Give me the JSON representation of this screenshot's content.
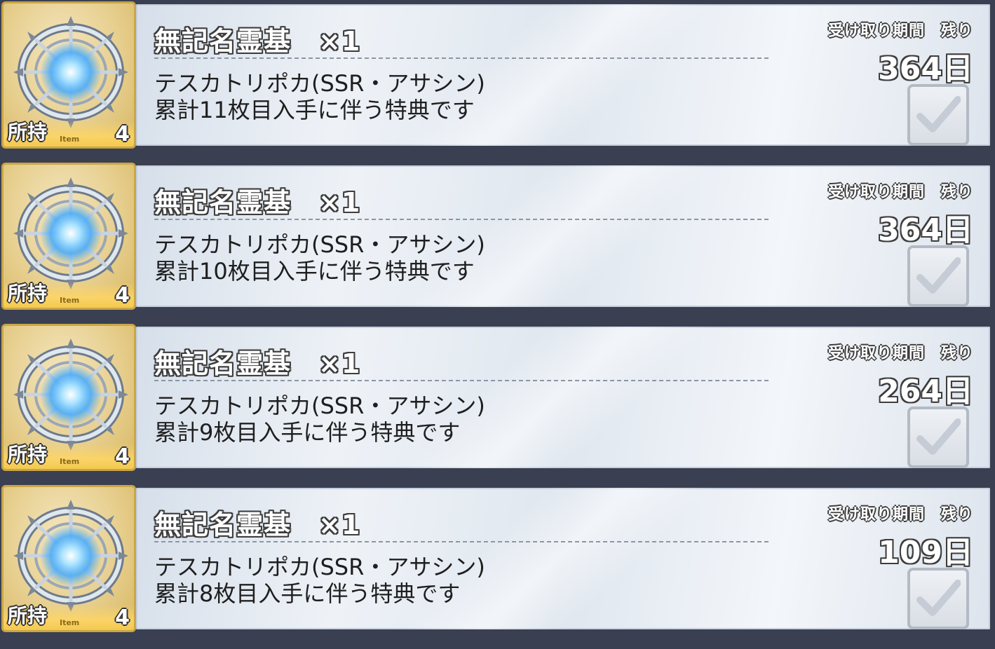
{
  "item_tag": "Item",
  "own_label": "所持",
  "period_label": "受け取り期間　残り",
  "rows": [
    {
      "title": "無記名霊基　×1",
      "desc_line1": "テスカトリポカ(SSR・アサシン)",
      "desc_line2": "累計11枚目入手に伴う特典です",
      "days": "364日",
      "own_count": "4"
    },
    {
      "title": "無記名霊基　×1",
      "desc_line1": "テスカトリポカ(SSR・アサシン)",
      "desc_line2": "累計10枚目入手に伴う特典です",
      "days": "364日",
      "own_count": "4"
    },
    {
      "title": "無記名霊基　×1",
      "desc_line1": "テスカトリポカ(SSR・アサシン)",
      "desc_line2": "累計9枚目入手に伴う特典です",
      "days": "264日",
      "own_count": "4"
    },
    {
      "title": "無記名霊基　×1",
      "desc_line1": "テスカトリポカ(SSR・アサシン)",
      "desc_line2": "累計8枚目入手に伴う特典です",
      "days": "109日",
      "own_count": "4"
    }
  ]
}
